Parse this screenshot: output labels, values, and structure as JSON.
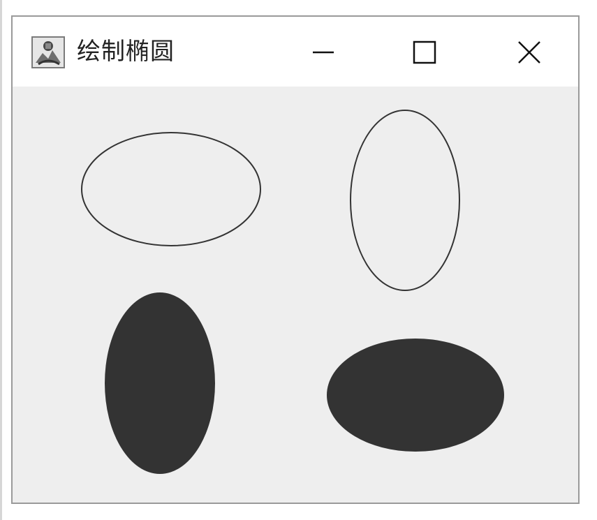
{
  "window": {
    "title": "绘制椭圆"
  },
  "icons": {
    "app": "java-app-icon",
    "minimize": "minimize-icon",
    "maximize": "maximize-icon",
    "close": "close-icon"
  },
  "canvas": {
    "background": "#eeeeee",
    "shapes": [
      {
        "name": "outlined-horizontal-ellipse",
        "style": "outline",
        "orientation": "horizontal"
      },
      {
        "name": "outlined-vertical-ellipse",
        "style": "outline",
        "orientation": "vertical"
      },
      {
        "name": "filled-vertical-ellipse",
        "style": "filled",
        "orientation": "vertical",
        "color": "#333333"
      },
      {
        "name": "filled-horizontal-ellipse",
        "style": "filled",
        "orientation": "horizontal",
        "color": "#333333"
      }
    ]
  }
}
